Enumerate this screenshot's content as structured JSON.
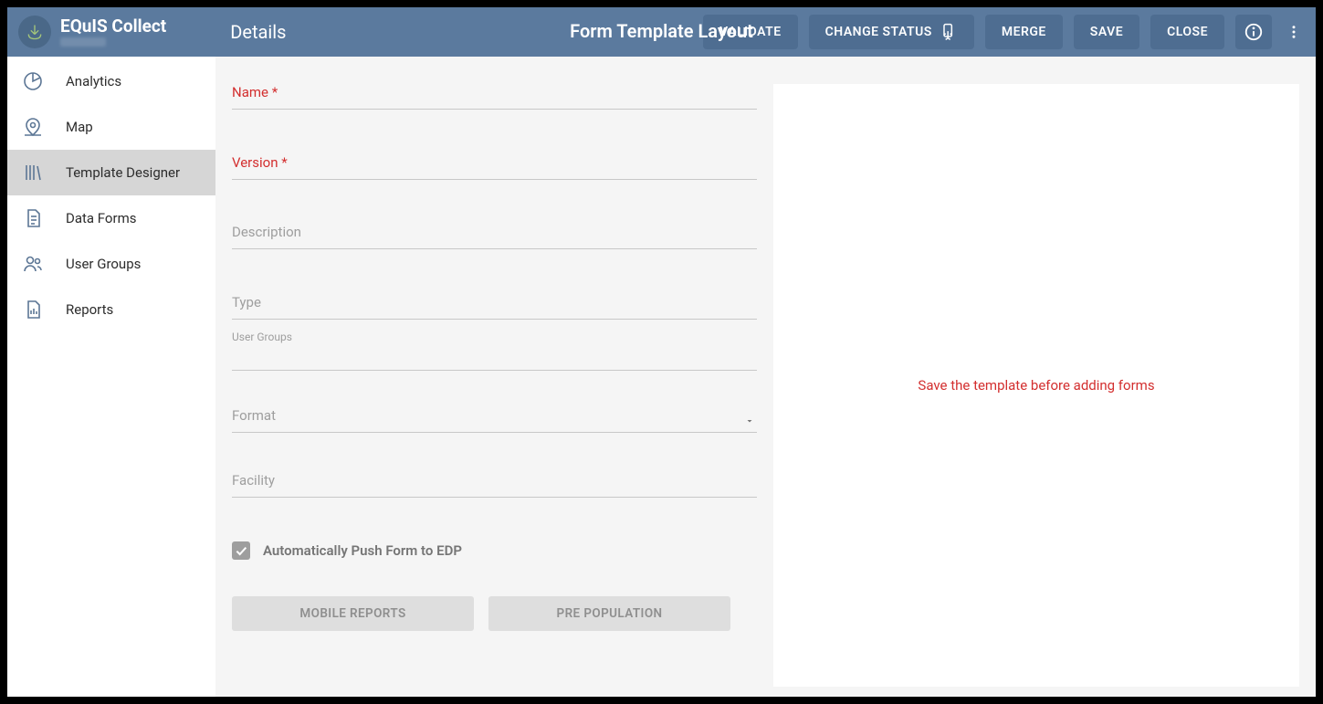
{
  "header": {
    "app_title": "EQuIS Collect",
    "section": "Details",
    "page_title": "Form Template Layout",
    "buttons": {
      "validate": "VALIDATE",
      "change_status": "CHANGE STATUS",
      "merge": "MERGE",
      "save": "SAVE",
      "close": "CLOSE"
    }
  },
  "sidebar": {
    "items": [
      {
        "label": "Analytics",
        "icon": "pie"
      },
      {
        "label": "Map",
        "icon": "map"
      },
      {
        "label": "Template Designer",
        "icon": "books"
      },
      {
        "label": "Data Forms",
        "icon": "doc"
      },
      {
        "label": "User Groups",
        "icon": "users"
      },
      {
        "label": "Reports",
        "icon": "report"
      }
    ]
  },
  "form": {
    "name_label": "Name *",
    "version_label": "Version *",
    "description_label": "Description",
    "type_label": "Type",
    "usergroups_label": "User Groups",
    "format_label": "Format",
    "facility_label": "Facility",
    "auto_push_label": "Automatically Push Form to EDP",
    "mobile_reports_btn": "MOBILE REPORTS",
    "pre_population_btn": "PRE POPULATION"
  },
  "preview": {
    "empty_msg": "Save the template before adding forms"
  }
}
